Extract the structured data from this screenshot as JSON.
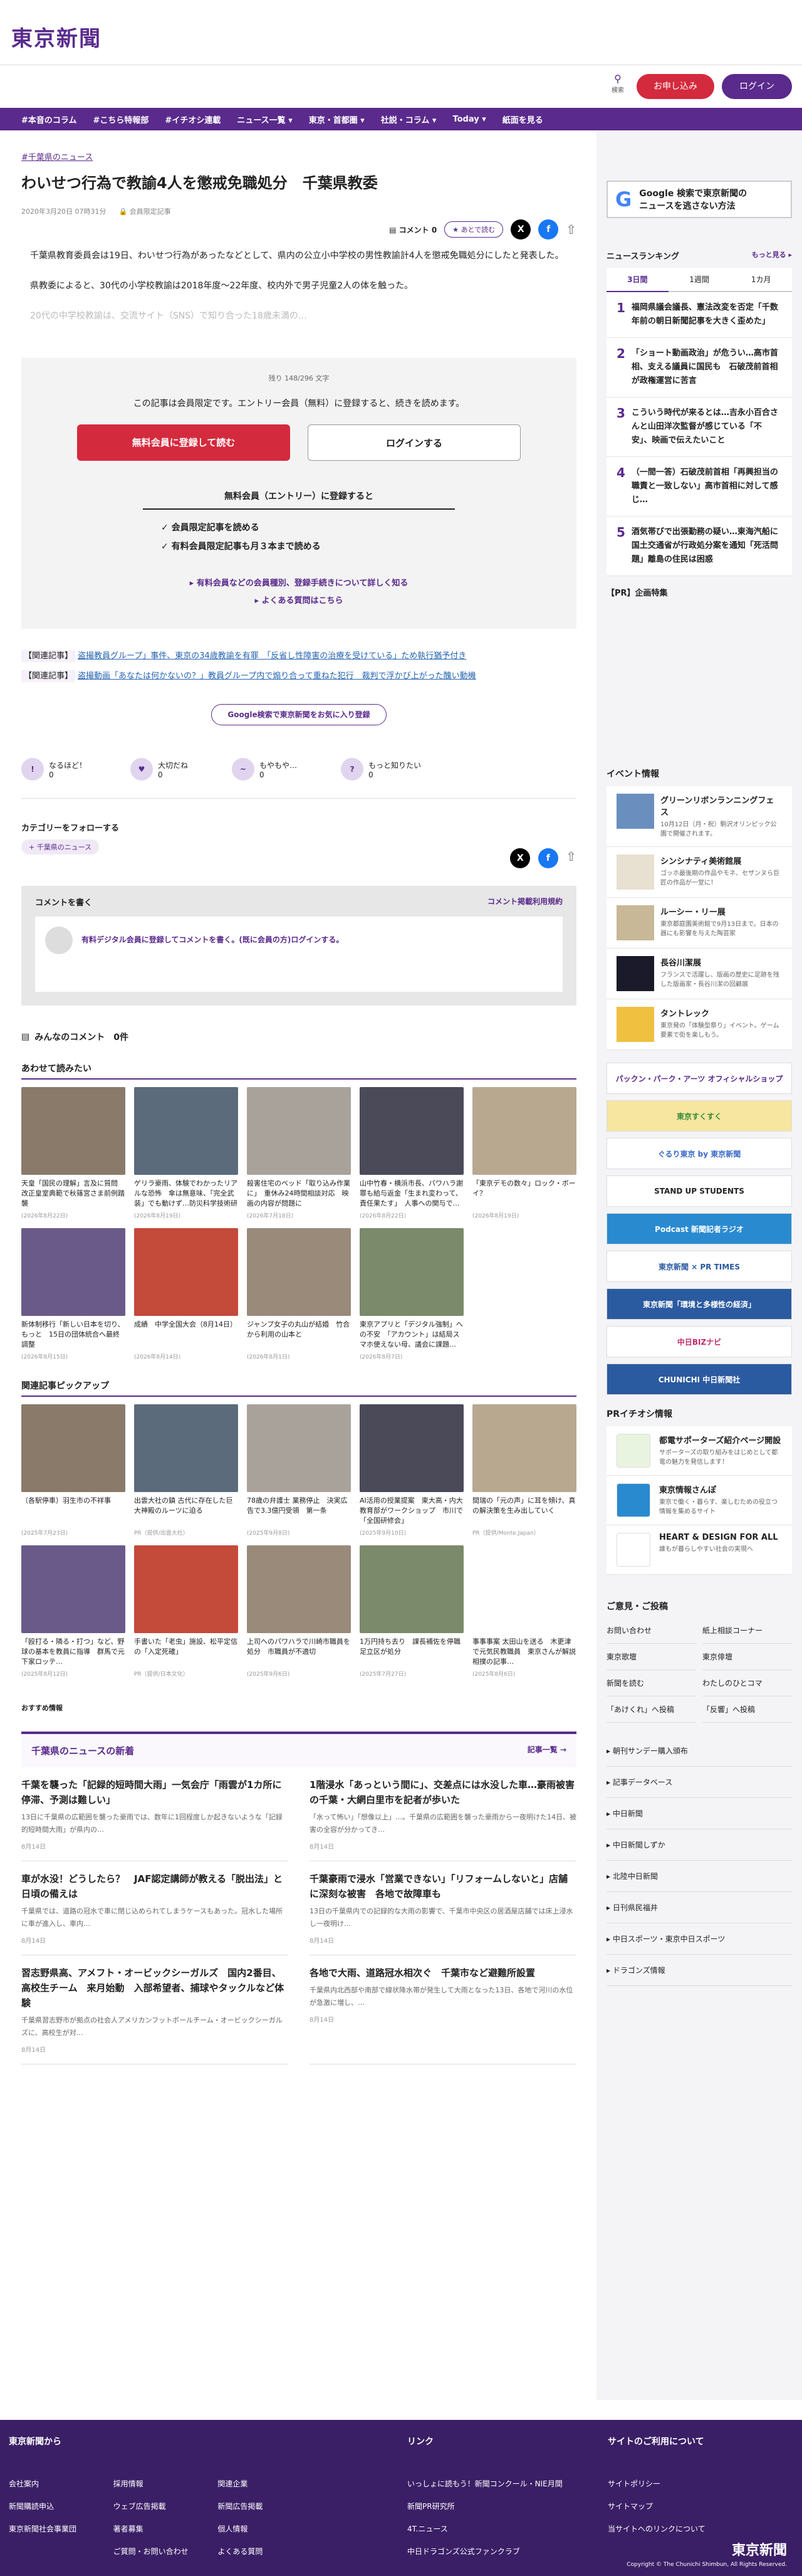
{
  "site": {
    "logo": "東京新聞",
    "search_label": "検索",
    "register": "お申し込み",
    "login": "ログイン"
  },
  "nav": [
    "#本音のコラム",
    "#こちら特報部",
    "#イチオシ連載",
    "ニュース一覧 ▾",
    "東京・首都圏 ▾",
    "社説・コラム ▾",
    "Today ▾",
    "紙面を見る"
  ],
  "article": {
    "crumb": "#千葉県のニュース",
    "title": "わいせつ行為で教諭4人を懲戒免職処分　千葉県教委",
    "date": "2020年3月20日 07時31分",
    "members": "会員限定記事",
    "comment_label": "コメント",
    "comment_count": "0",
    "read_btn": "あとで読む",
    "p1": "千葉県教育委員会は19日、わいせつ行為があったなどとして、県内の公立小中学校の男性教諭計4人を懲戒免職処分にしたと発表した。",
    "p2": "県教委によると、30代の小学校教諭は2018年度～22年度、校内外で男子児童2人の体を触った。",
    "p3": "20代の中学校教諭は、交流サイト（SNS）で知り合った18歳未満の…"
  },
  "paywall": {
    "remain": "残り 148/296 文字",
    "msg": "この記事は会員限定です。エントリー会員（無料）に登録すると、続きを読めます。",
    "red_btn": "無料会員に登録して読む",
    "white_btn": "ログインする",
    "sub": "無料会員（エントリー）に登録すると",
    "b1": "✓ 会員限定記事を読める",
    "b2": "✓ 有料会員限定記事も月３本まで読める",
    "l1": "▸ 有料会員などの会員種別、登録手続きについて詳しく知る",
    "l2": "▸ よくある質問はこちら"
  },
  "related": [
    {
      "label": "【関連記事】",
      "text": "盗撮教員グループ」事件、東京の34歳教諭を有罪　「反省し性障害の治療を受けている」ため執行猶予付き"
    },
    {
      "label": "【関連記事】",
      "text": "盗撮動画「あなたは何かないの？」教員グループ内で煽り合って重ねた犯行　裁判で浮かび上がった醜い動機"
    }
  ],
  "google_btn": "Google検索で東京新聞をお気に入り登録",
  "reactions": [
    {
      "icon": "!",
      "label": "なるほど！",
      "count": "0"
    },
    {
      "icon": "♥",
      "label": "大切だね",
      "count": "0"
    },
    {
      "icon": "~",
      "label": "もやもや…",
      "count": "0"
    },
    {
      "icon": "?",
      "label": "もっと知りたい",
      "count": "0"
    }
  ],
  "follow": {
    "title": "カテゴリーをフォローする",
    "tag": "+ 千葉県のニュース"
  },
  "comment": {
    "head": "コメントを書く",
    "rules": "コメント掲載利用規約",
    "prompt": "有料デジタル会員に登録してコメントを書く。(既に会員の方)ログインする。"
  },
  "all_comments": "みんなのコメント　0件",
  "recommend": {
    "title": "あわせて読みたい",
    "items": [
      {
        "t": "天皇「国民の理解」言及に質問　改正皇室典範で秋篠宮さま前例踏襲",
        "d": "(2026年8月22日)"
      },
      {
        "t": "ゲリラ豪雨、体験でわかったリアルな恐怖　傘は無意味、「完全武装」でも動けず…防災科学技術研究所",
        "d": "(2026年8月19日)"
      },
      {
        "t": "殺害住宅のベッド「取り込み作業に」　重休み24時間相談対応　映画の内容が問題に",
        "d": "(2026年7月18日)"
      },
      {
        "t": "山中竹春・横浜市長、パワハラ謝罪も給与返金「生まれ変わって、責任果たす」　人事への関与で…",
        "d": "(2026年8月22日)"
      },
      {
        "t": "「東京デモの数々」ロック・ボーイ？",
        "d": "(2026年8月19日)"
      },
      {
        "t": "新体制移行「新しい日本を切り、もっと　15日の団体統合へ最終調整",
        "d": "(2026年8月15日)"
      },
      {
        "t": "成績　中学全国大会（8月14日）",
        "d": "(2026年8月14日)"
      },
      {
        "t": "ジャンプ女子の丸山が結婚　竹合から利用の山本と",
        "d": "(2026年8月1日)"
      },
      {
        "t": "東京アプリと「デジタル強制」への不安　「アカウント」は結局スマホ使えない母、議会に課題…",
        "d": "(2026年8月7日)"
      },
      {
        "t": "",
        "d": ""
      }
    ]
  },
  "pickup": {
    "title": "関連記事ピックアップ",
    "items": [
      {
        "t": "（各駅停車）羽生市の不祥事",
        "d": "(2025年7月23日)"
      },
      {
        "t": "出雲大社の鎮 古代に存在した巨大神殿のルーツに迫る",
        "d": "PR（提供/出雲大社）"
      },
      {
        "t": "78歳の弁護士 業務停止　決実広告で3.3億円受領　第一条",
        "d": "(2025年9月8日)"
      },
      {
        "t": "AI活用の授業提案　東大高・内大教育部がワークショップ　市川で「全国研修会」",
        "d": "(2025年9月10日)"
      },
      {
        "t": "間瑞の「元の声」に耳を傾け、真の解決策を生み出していく",
        "d": "PR（提供/Monte.Japan）"
      },
      {
        "t": "「殴打る・隣る・打つ」など、野球の基本を教員に指導　群馬で元下家ロッテ…",
        "d": "(2025年8月12日)"
      },
      {
        "t": "手書いた「老虫」施設、松平定信の「入定死確」",
        "d": "PR（提供/日本文化）"
      },
      {
        "t": "上司へのパワハラで川崎市職員を処分　市職員が不適切",
        "d": "(2025年9月6日)"
      },
      {
        "t": "1万円持ち去り　課長補佐を停職　足立区が処分",
        "d": "(2025年7月27日)"
      },
      {
        "t": "事事事案 太田山を送る　木更津で元気民教職員　東京さんが解説　相撲の記事…",
        "d": "(2025年8月6日)"
      }
    ]
  },
  "osusume": "おすすめ情報",
  "news": {
    "title": "千葉県のニュースの新着",
    "more": "記事一覧 →",
    "items": [
      {
        "t": "千葉を襲った「記録的短時間大雨」一気会庁「雨雲が1カ所に停滞、予測は難しい」",
        "x": "13日に千葉県の広範囲を襲った豪雨では、数年に1回程度しか起きないような「記録的短時間大雨」が県内の…",
        "d": "8月14日"
      },
      {
        "t": "1階浸水「あっという間に」、交差点には水没した車…豪雨被害の千葉・大網白里市を記者が歩いた",
        "x": "「水って怖い」「想像以上」…。千葉県の広範囲を襲った豪雨から一夜明けた14日、被害の全容が分かってき…",
        "d": "8月14日"
      },
      {
        "t": "車が水没！どうしたら？　JAF認定講師が教える「脱出法」と日頃の備えは",
        "x": "千葉県では、道路の冠水で車に閉じ込められてしまうケースもあった。冠水した場所に車が進入し、車内…",
        "d": "8月14日"
      },
      {
        "t": "千葉豪雨で浸水「営業できない」「リフォームしないと」店舗に深刻な被害　各地で故障車も",
        "x": "13日の千葉県内での記録的な大雨の影響で、千葉市中央区の居酒屋店舗では床上浸水し一夜明け…",
        "d": "8月14日"
      },
      {
        "t": "習志野県高、アメフト・オービックシーガルズ　国内2番目、高校生チーム　来月始動　入部希望者、捕球やタックルなど体験",
        "x": "千葉県習志野市が拠点の社会人アメリカンフットボールチーム・オービックシーガルズに、高校生が対…",
        "d": "8月14日"
      },
      {
        "t": "各地で大雨、道路冠水相次ぐ　千葉市など避難所設置",
        "x": "千葉県内北西部や南部で線状降水帯が発生して大雨となった13日、各地で河川の水位が急激に増し、…",
        "d": "8月14日"
      }
    ]
  },
  "side": {
    "gbox": "Google 検索で東京新聞の\nニュースを逃さない方法",
    "rank_title": "ニュースランキング",
    "rank_more": "もっと見る ▸",
    "tabs": [
      "3日間",
      "1週間",
      "1カ月"
    ],
    "rank": [
      "福岡県議会議長、憲法改変を否定「千数年前の朝日新聞記事を大きく歪めた」",
      "「ショート動画政治」が危うい…高市首相、支える議員に国民も　石破茂前首相が政権運営に苦言",
      "こういう時代が来るとは…吉永小百合さんと山田洋次監督が感じている「不安」、映画で伝えたいこと",
      "（一間一答）石破茂前首相「再興担当の職責と一致しない」高市首相に対して感じ…",
      "酒気帯びで出張勤務の疑い…東海汽船に国土交通省が行政処分案を通知「死活問題」離島の住民は困惑"
    ],
    "pr": "【PR】企画特集",
    "event_title": "イベント情報",
    "events": [
      {
        "t": "グリーンリボンランニングフェス",
        "x": "10月12日（月・祝）駒沢オリンピック公園で開催されます。"
      },
      {
        "t": "シンシナティ美術館展",
        "x": "ゴッホ最後期の作品やモネ、セザンヌら巨匠の作品が一堂に！"
      },
      {
        "t": "ルーシー・リー展",
        "x": "東京都庭園美術館で9月13日まで。日本の器にも影響を与えた陶芸家"
      },
      {
        "t": "長谷川潔展",
        "x": "フランスで活躍し、版画の歴史に足跡を残した版画家・長谷川潔の回顧展"
      },
      {
        "t": "タントレック",
        "x": "東京発の「体験型祭り」イベント。ゲーム要素で街を楽しもう。"
      }
    ],
    "banners": [
      "パックン・パーク・アーツ オフィシャルショップ",
      "東京すくすく",
      "ぐるり東京 by 東京新聞",
      "STAND UP STUDENTS",
      "Podcast 新聞記者ラジオ",
      "東京新聞 × PR TIMES",
      "東京新聞「環境と多様性の経済」",
      "中日BIZナビ",
      "CHUNICHI 中日新聞社"
    ],
    "iji_title": "PRイチオシ情報",
    "iji": [
      {
        "t": "都電サポーターズ紹介ページ開設",
        "x": "サポーターズの取り組みをはじめとして都電の魅力を発信します！"
      },
      {
        "t": "東京情報さんぽ",
        "x": "東京で働く・暮らす、楽しむための役立つ情報を集めるサイト"
      },
      {
        "t": "HEART & DESIGN FOR ALL",
        "x": "誰もが暮らしやすい社会の実現へ"
      }
    ],
    "opinion_title": "ご意見・ご投稿",
    "opinion": [
      "お問い合わせ",
      "紙上相談コーナー",
      "東京歌壇",
      "東京俳壇",
      "新聞を読む",
      "わたしのひとコマ",
      "「あけくれ」へ投稿",
      "「反響」へ投稿"
    ],
    "links": [
      "朝刊サンデー購入頒布",
      "記事データベース",
      "中日新聞",
      "中日新聞しずか",
      "北陸中日新聞",
      "日刊県民福井",
      "中日スポーツ・東京中日スポーツ",
      "ドラゴンズ情報"
    ]
  },
  "footer": {
    "c1": "東京新聞から",
    "c1l": [
      "会社案内",
      "採用情報",
      "関連企業",
      "新聞購読申込",
      "ウェブ広告掲載",
      "新聞広告掲載",
      "東京新聞社会事業団",
      "著者募集",
      "個人情報",
      "",
      "ご質問・お問い合わせ",
      "よくある質問"
    ],
    "c2": "リンク",
    "c2l": [
      "いっしょに読もう！新聞コンクール・NIE月間",
      "新聞PR研究所",
      "4T.ニュース",
      "中日ドラゴンズ公式ファンクラブ"
    ],
    "c3": "サイトのご利用について",
    "c3l": [
      "サイトポリシー",
      "サイトマップ",
      "当サイトへのリンクについて"
    ],
    "logo": "東京新聞",
    "copy": "Copyright © The Chunichi Shimbun, All Rights Reserved."
  },
  "colors": {
    "brand": "#5a2a8c",
    "red": "#d42a3d",
    "footer": "#3b1f66"
  }
}
